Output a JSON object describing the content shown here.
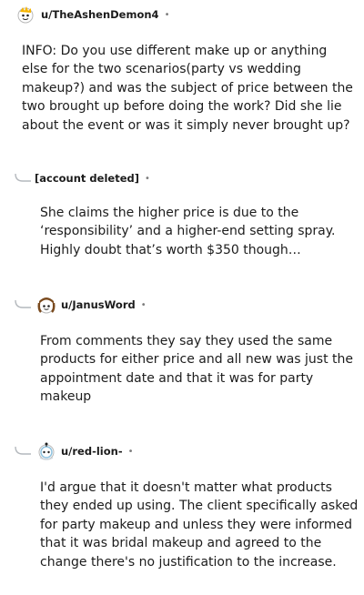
{
  "comments": [
    {
      "author": "u/TheAshenDemon4",
      "separator": "•",
      "avatar_icon": "snoo-avatar-icon",
      "lines": [
        "INFO: Do you use different make up or anything",
        "else for the two scenarios(party vs wedding",
        "makeup?) and was the subject of price between the",
        "two brought up before doing the work? Did she lie",
        "about the event or was it simply never brought up?"
      ]
    },
    {
      "author": "[account deleted]",
      "separator": "•",
      "reply_icon": "reply-arrow-icon",
      "lines": [
        "She claims the higher price is due to the",
        "‘responsibility’ and a higher-end setting spray.",
        "Highly doubt that’s worth $350 though…"
      ]
    },
    {
      "author": "u/JanusWord",
      "separator": "•",
      "reply_icon": "reply-arrow-icon",
      "avatar_icon": "snoo-avatar-icon",
      "lines": [
        "From comments they say they used the same",
        "products for either price and all new was just the",
        "appointment date and that it was for party",
        "makeup"
      ]
    },
    {
      "author": "u/red-lion-",
      "separator": "•",
      "reply_icon": "reply-arrow-icon",
      "avatar_icon": "snoo-avatar-icon",
      "lines": [
        "I'd argue that it doesn't matter what products",
        "they ended up using. The client specifically asked",
        "for party makeup and unless they were informed",
        "that it was bridal makeup and agreed to the",
        "change there's no justification to the increase."
      ]
    }
  ]
}
